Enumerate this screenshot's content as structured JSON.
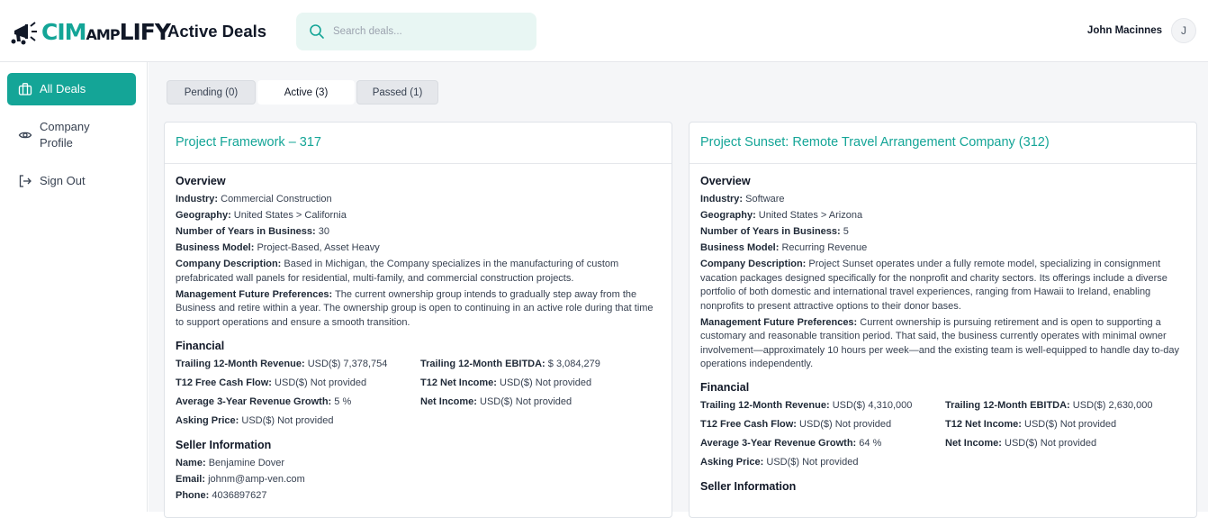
{
  "app": {
    "brand_part1": "CIM",
    "brand_part2": "AMP",
    "brand_part3": "LIFY"
  },
  "header": {
    "title": "Active Deals",
    "search_placeholder": "Search deals...",
    "user_name": "John Macinnes",
    "avatar_initial": "J"
  },
  "sidebar": {
    "items": [
      {
        "label": "All Deals",
        "icon": "briefcase-icon"
      },
      {
        "label": "Company Profile",
        "icon": "eye-icon"
      },
      {
        "label": "Sign Out",
        "icon": "sign-out-icon"
      }
    ]
  },
  "tabs": [
    {
      "label": "Pending (0)"
    },
    {
      "label": "Active (3)"
    },
    {
      "label": "Passed (1)"
    }
  ],
  "labels": {
    "overview": "Overview",
    "industry": "Industry:",
    "geography": "Geography:",
    "years": "Number of Years in Business:",
    "model": "Business Model:",
    "description": "Company Description:",
    "mgmt": "Management Future Preferences:",
    "financial": "Financial",
    "t12_rev": "Trailing 12-Month Revenue:",
    "t12_ebitda": "Trailing 12-Month EBITDA:",
    "t12_fcf": "T12 Free Cash Flow:",
    "t12_net": "T12 Net Income:",
    "avg_growth": "Average 3-Year Revenue Growth:",
    "net_income": "Net Income:",
    "asking": "Asking Price:",
    "seller": "Seller Information",
    "name": "Name:",
    "email": "Email:",
    "phone": "Phone:"
  },
  "deals": [
    {
      "title": "Project Framework – 317",
      "industry": "Commercial Construction",
      "geography": "United States > California",
      "years": "30",
      "model": "Project-Based, Asset Heavy",
      "description": "Based in Michigan, the Company specializes in the manufacturing of custom prefabricated wall panels for residential, multi-family, and commercial construction projects.",
      "mgmt": "The current ownership group intends to gradually step away from the Business and retire within a year. The ownership group is open to continuing in an active role during that time to support operations and ensure a smooth transition.",
      "t12_rev": "USD($) 7,378,754",
      "t12_ebitda": "$ 3,084,279",
      "t12_fcf": "USD($) Not provided",
      "t12_net": "USD($) Not provided",
      "avg_growth": "5 %",
      "net_income": "USD($) Not provided",
      "asking": "USD($) Not provided",
      "seller_name": "Benjamine Dover",
      "seller_email": "johnm@amp-ven.com",
      "seller_phone": "4036897627"
    },
    {
      "title": "Project Sunset: Remote Travel Arrangement Company (312)",
      "industry": "Software",
      "geography": "United States > Arizona",
      "years": "5",
      "model": "Recurring Revenue",
      "description": "Project Sunset operates under a fully remote model, specializing in consignment vacation packages designed specifically for the nonprofit and charity sectors. Its offerings include a diverse portfolio of both domestic and international travel experiences, ranging from Hawaii to Ireland, enabling nonprofits to present attractive options to their donor bases.",
      "mgmt": "Current ownership is pursuing retirement and is open to supporting a customary and reasonable transition period. That said, the business currently operates with minimal owner involvement—approximately 10 hours per week—and the existing team is well-equipped to handle day to-day operations independently.",
      "t12_rev": "USD($) 4,310,000",
      "t12_ebitda": "USD($) 2,630,000",
      "t12_fcf": "USD($) Not provided",
      "t12_net": "USD($) Not provided",
      "avg_growth": "64 %",
      "net_income": "USD($) Not provided",
      "asking": "USD($) Not provided"
    }
  ]
}
